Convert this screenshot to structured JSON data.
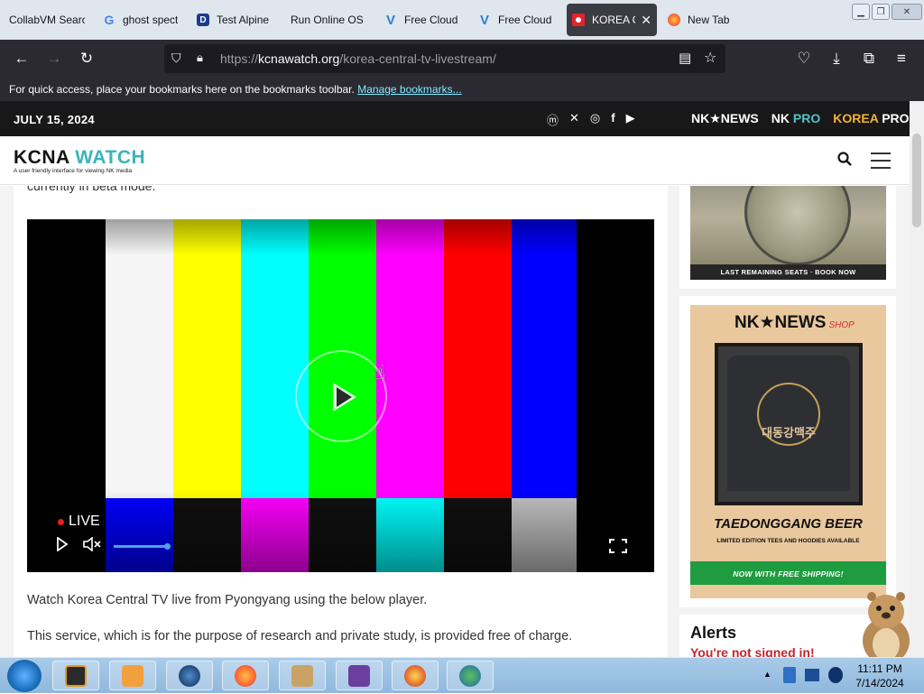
{
  "browser": {
    "tabs": [
      {
        "title": "CollabVM Search",
        "favicon": "collabvm-icon"
      },
      {
        "title": "ghost spect",
        "favicon": "google-icon"
      },
      {
        "title": "Test Alpine",
        "favicon": "d-icon"
      },
      {
        "title": "Run Online OS",
        "favicon": "blank-icon"
      },
      {
        "title": "Free Cloud",
        "favicon": "v-icon"
      },
      {
        "title": "Free Cloud",
        "favicon": "v-icon"
      },
      {
        "title": "KOREA C",
        "favicon": "nk-flag-icon",
        "active": true
      },
      {
        "title": "New Tab",
        "favicon": "firefox-icon"
      }
    ],
    "url_prefix": "https://",
    "url_domain": "kcnawatch.org",
    "url_path": "/korea-central-tv-livestream/",
    "bookmarks_bar_text": "For quick access, place your bookmarks here on the bookmarks toolbar.",
    "bookmarks_bar_link": "Manage bookmarks..."
  },
  "site": {
    "date": "JULY 15, 2024",
    "brands": {
      "nknews": "NK★NEWS",
      "nkpro_a": "NK",
      "nkpro_b": "PRO",
      "korpro_a": "KOREA",
      "korpro_b": "PRO"
    },
    "logo_main": "KCNA",
    "logo_accent": "WATCH",
    "tagline": "A user friendly interface for viewing NK media"
  },
  "article": {
    "beta_text": "currently in beta mode.",
    "live_label": "LIVE",
    "para1": "Watch Korea Central TV live from Pyongyang using the below player.",
    "para2": "This service, which is for the purpose of research and private study, is provided free of charge.",
    "volume_level": 1.0
  },
  "sidebar": {
    "ad1_caption": "LAST REMAINING SEATS · BOOK NOW",
    "shop_name": "NK★NEWS",
    "shop_label": "SHOP",
    "shirt_text": "대동강맥주",
    "shirt_emblem": "TAEDONGGANG",
    "beer_title": "TAEDONGGANG BEER",
    "limited": "LIMITED EDITION TEES AND HOODIES AVAILABLE",
    "shipping": "NOW WITH FREE SHIPPING!",
    "alerts_title": "Alerts",
    "alerts_signin": "You're not signed in!"
  },
  "taskbar": {
    "time": "11:11 PM",
    "date": "7/14/2024"
  },
  "colors": {
    "test_bars_top": [
      "#000000",
      "#f5f5f5",
      "#ffff00",
      "#00ffff",
      "#00ff00",
      "#ff00ff",
      "#ff0000",
      "#0000ff",
      "#000000"
    ],
    "test_bars_bottom": [
      "#000000",
      "#0000ff",
      "#101010",
      "#ff00ff",
      "#101010",
      "#00ffff",
      "#101010",
      "#c0c0c0",
      "#000000"
    ],
    "accent": "#38b5b9"
  }
}
